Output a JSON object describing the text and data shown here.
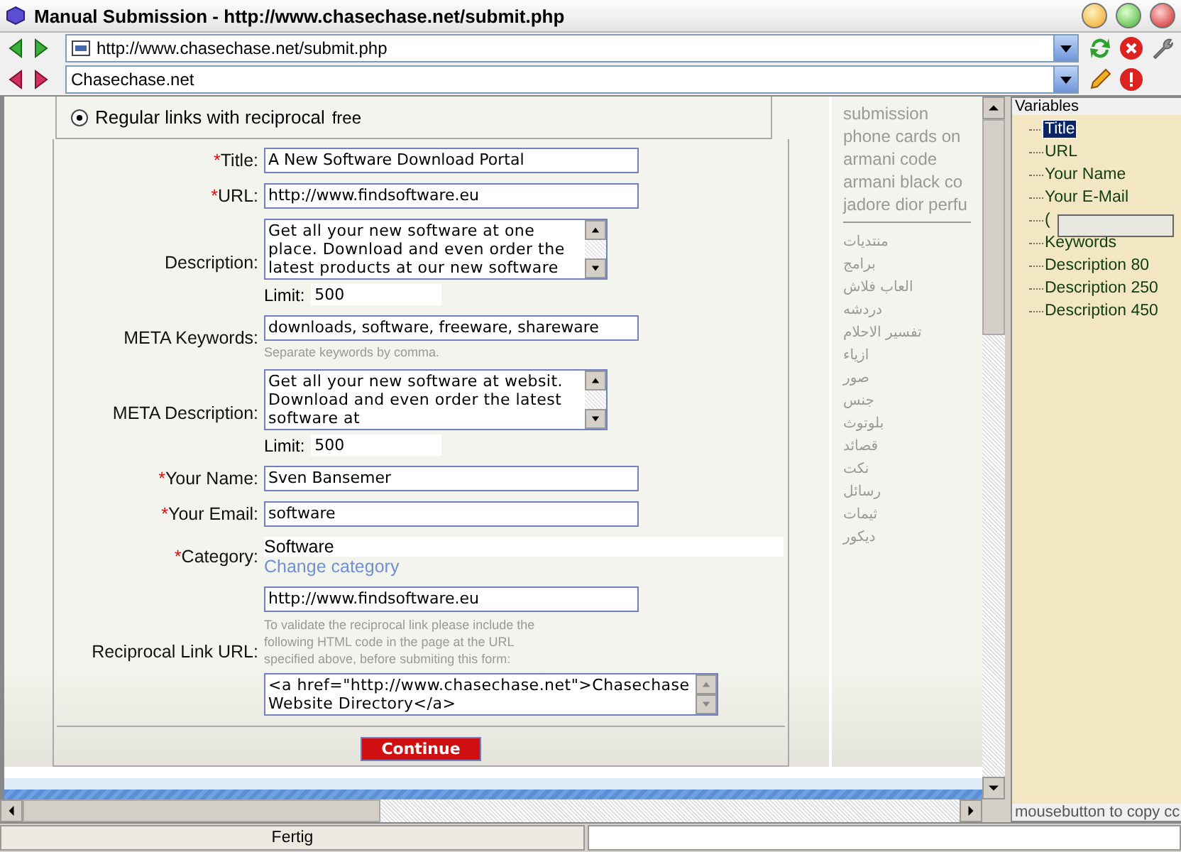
{
  "window": {
    "title": "Manual Submission - http://www.chasechase.net/submit.php"
  },
  "toolbar": {
    "address": "http://www.chasechase.net/submit.php",
    "site": "Chasechase.net"
  },
  "form": {
    "radio": {
      "label": "Regular links with reciprocal",
      "price": "free",
      "selected": true
    },
    "fields": [
      {
        "kind": "input",
        "label": "Title:",
        "marker": "*",
        "value": "A New Software Download Portal"
      },
      {
        "kind": "input",
        "label": "URL:",
        "marker": "*",
        "value": "http://www.findsoftware.eu"
      },
      {
        "kind": "textarea",
        "label": "Description:",
        "value": "Get all your new software at one place. Download and even order the latest products at our new software",
        "limit_label": "Limit:",
        "limit": "500"
      },
      {
        "kind": "input",
        "label": "META Keywords:",
        "value": "downloads, software, freeware, shareware",
        "hint": "Separate keywords by comma."
      },
      {
        "kind": "textarea",
        "label": "META Description:",
        "value": "Get all your new software at websit. Download and even order the latest software at",
        "limit_label": "Limit:",
        "limit": "500"
      },
      {
        "kind": "input",
        "label": "Your Name:",
        "marker": "*",
        "value": "Sven Bansemer"
      },
      {
        "kind": "input",
        "label": "Your Email:",
        "marker": "*",
        "value": "software"
      },
      {
        "kind": "category",
        "label": "Category:",
        "marker": "*",
        "value": "Software",
        "link": "Change category"
      },
      {
        "kind": "reciprocal",
        "label": "Reciprocal Link URL:",
        "value": "http://www.findsoftware.eu",
        "hint": "To validate the reciprocal link please include the following HTML code in the page at the URL specified above, before submiting this form:",
        "code": "<a href=\"http://www.chasechase.net\">Chasechase Website Directory</a>"
      }
    ],
    "continue": "Continue"
  },
  "link_list": {
    "latin": [
      "submission",
      "phone cards on",
      "armani code",
      "armani black co",
      "jadore dior perfu"
    ],
    "arabic": [
      "منتديات",
      "برامج",
      "العاب فلاش",
      "دردشه",
      "تفسير الاحلام",
      "ازياء",
      "صور",
      "جنس",
      "بلوتوث",
      "قصائد",
      "نكت",
      "رسائل",
      "ثيمات",
      "ديكور"
    ]
  },
  "variables": {
    "title": "Variables",
    "items": [
      {
        "label": "Title",
        "selected": true
      },
      {
        "label": "URL",
        "selected": false
      },
      {
        "label": "Your Name",
        "selected": false
      },
      {
        "label": "Your E-Mail",
        "selected": false
      },
      {
        "label": "(",
        "selected": false
      },
      {
        "label": "Keywords",
        "selected": false
      },
      {
        "label": "Description 80",
        "selected": false
      },
      {
        "label": "Description 250",
        "selected": false
      },
      {
        "label": "Description 450",
        "selected": false
      }
    ],
    "hint": "mousebutton to copy cc"
  },
  "status_bar": {
    "text": "Fertig"
  }
}
